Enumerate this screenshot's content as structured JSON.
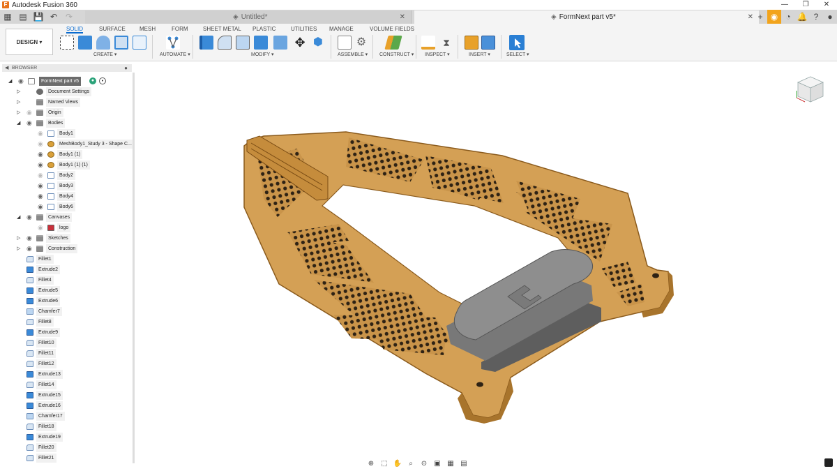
{
  "window": {
    "title": "Autodesk Fusion 360",
    "logo": "F"
  },
  "tabs": [
    {
      "label": "Untitled*",
      "active": false
    },
    {
      "label": "FormNext part v5*",
      "active": true
    }
  ],
  "workspace": {
    "label": "DESIGN ▾"
  },
  "toolbar_tabs": [
    "SOLID",
    "SURFACE",
    "MESH",
    "FORM",
    "SHEET METAL",
    "PLASTIC",
    "UTILITIES",
    "MANAGE",
    "VOLUME FIELDS"
  ],
  "groups": {
    "create": "CREATE ▾",
    "automate": "AUTOMATE ▾",
    "modify": "MODIFY ▾",
    "assemble": "ASSEMBLE ▾",
    "construct": "CONSTRUCT ▾",
    "inspect": "INSPECT ▾",
    "insert": "INSERT ▾",
    "select": "SELECT ▾"
  },
  "browser": {
    "title": "BROWSER",
    "root": "FormNext part v5",
    "items": [
      {
        "label": "Document Settings",
        "icon": "gear",
        "indent": 1,
        "expander": "▷",
        "eye": ""
      },
      {
        "label": "Named Views",
        "icon": "folder",
        "indent": 1,
        "expander": "▷",
        "eye": ""
      },
      {
        "label": "Origin",
        "icon": "folder",
        "indent": 1,
        "expander": "▷",
        "eye": "off"
      },
      {
        "label": "Bodies",
        "icon": "folder",
        "indent": 1,
        "expander": "◢",
        "eye": "on"
      },
      {
        "label": "Body1",
        "icon": "body-outline",
        "indent": 2,
        "expander": "",
        "eye": "off"
      },
      {
        "label": "MeshBody1_Study 3 - Shape C...",
        "icon": "body-mesh",
        "indent": 2,
        "expander": "",
        "eye": "off"
      },
      {
        "label": "Body1 (1)",
        "icon": "body-mesh",
        "indent": 2,
        "expander": "",
        "eye": "on"
      },
      {
        "label": "Body1 (1) (1)",
        "icon": "body-mesh",
        "indent": 2,
        "expander": "",
        "eye": "on"
      },
      {
        "label": "Body2",
        "icon": "body-outline",
        "indent": 2,
        "expander": "",
        "eye": "off"
      },
      {
        "label": "Body3",
        "icon": "body-outline",
        "indent": 2,
        "expander": "",
        "eye": "on"
      },
      {
        "label": "Body4",
        "icon": "body-outline",
        "indent": 2,
        "expander": "",
        "eye": "on"
      },
      {
        "label": "Body6",
        "icon": "body-outline",
        "indent": 2,
        "expander": "",
        "eye": "on"
      },
      {
        "label": "Canvases",
        "icon": "folder",
        "indent": 1,
        "expander": "◢",
        "eye": "on"
      },
      {
        "label": "logo",
        "icon": "canvas",
        "indent": 2,
        "expander": "",
        "eye": "off"
      },
      {
        "label": "Sketches",
        "icon": "folder",
        "indent": 1,
        "expander": "▷",
        "eye": "on"
      },
      {
        "label": "Construction",
        "icon": "folder",
        "indent": 1,
        "expander": "▷",
        "eye": "on"
      }
    ],
    "features": [
      {
        "label": "Fillet1",
        "icon": "feat-fillet"
      },
      {
        "label": "Extrude2",
        "icon": "feat-extrude"
      },
      {
        "label": "Fillet4",
        "icon": "feat-fillet"
      },
      {
        "label": "Extrude5",
        "icon": "feat-extrude"
      },
      {
        "label": "Extrude6",
        "icon": "feat-extrude"
      },
      {
        "label": "Chamfer7",
        "icon": "feat-chamfer"
      },
      {
        "label": "Fillet8",
        "icon": "feat-fillet"
      },
      {
        "label": "Extrude9",
        "icon": "feat-extrude"
      },
      {
        "label": "Fillet10",
        "icon": "feat-fillet"
      },
      {
        "label": "Fillet11",
        "icon": "feat-fillet"
      },
      {
        "label": "Fillet12",
        "icon": "feat-fillet"
      },
      {
        "label": "Extrude13",
        "icon": "feat-extrude"
      },
      {
        "label": "Fillet14",
        "icon": "feat-fillet"
      },
      {
        "label": "Extrude15",
        "icon": "feat-extrude"
      },
      {
        "label": "Extrude16",
        "icon": "feat-extrude"
      },
      {
        "label": "Chamfer17",
        "icon": "feat-chamfer"
      },
      {
        "label": "Fillet18",
        "icon": "feat-fillet"
      },
      {
        "label": "Extrude19",
        "icon": "feat-extrude"
      },
      {
        "label": "Fillet20",
        "icon": "feat-fillet"
      },
      {
        "label": "Fillet21",
        "icon": "feat-fillet"
      }
    ]
  },
  "colors": {
    "accent": "#0a6bcf",
    "part_orange": "#d4a055",
    "part_dark": "#a8742c",
    "clip_gray": "#8e8e8e",
    "job_status": "#f2a41c"
  }
}
